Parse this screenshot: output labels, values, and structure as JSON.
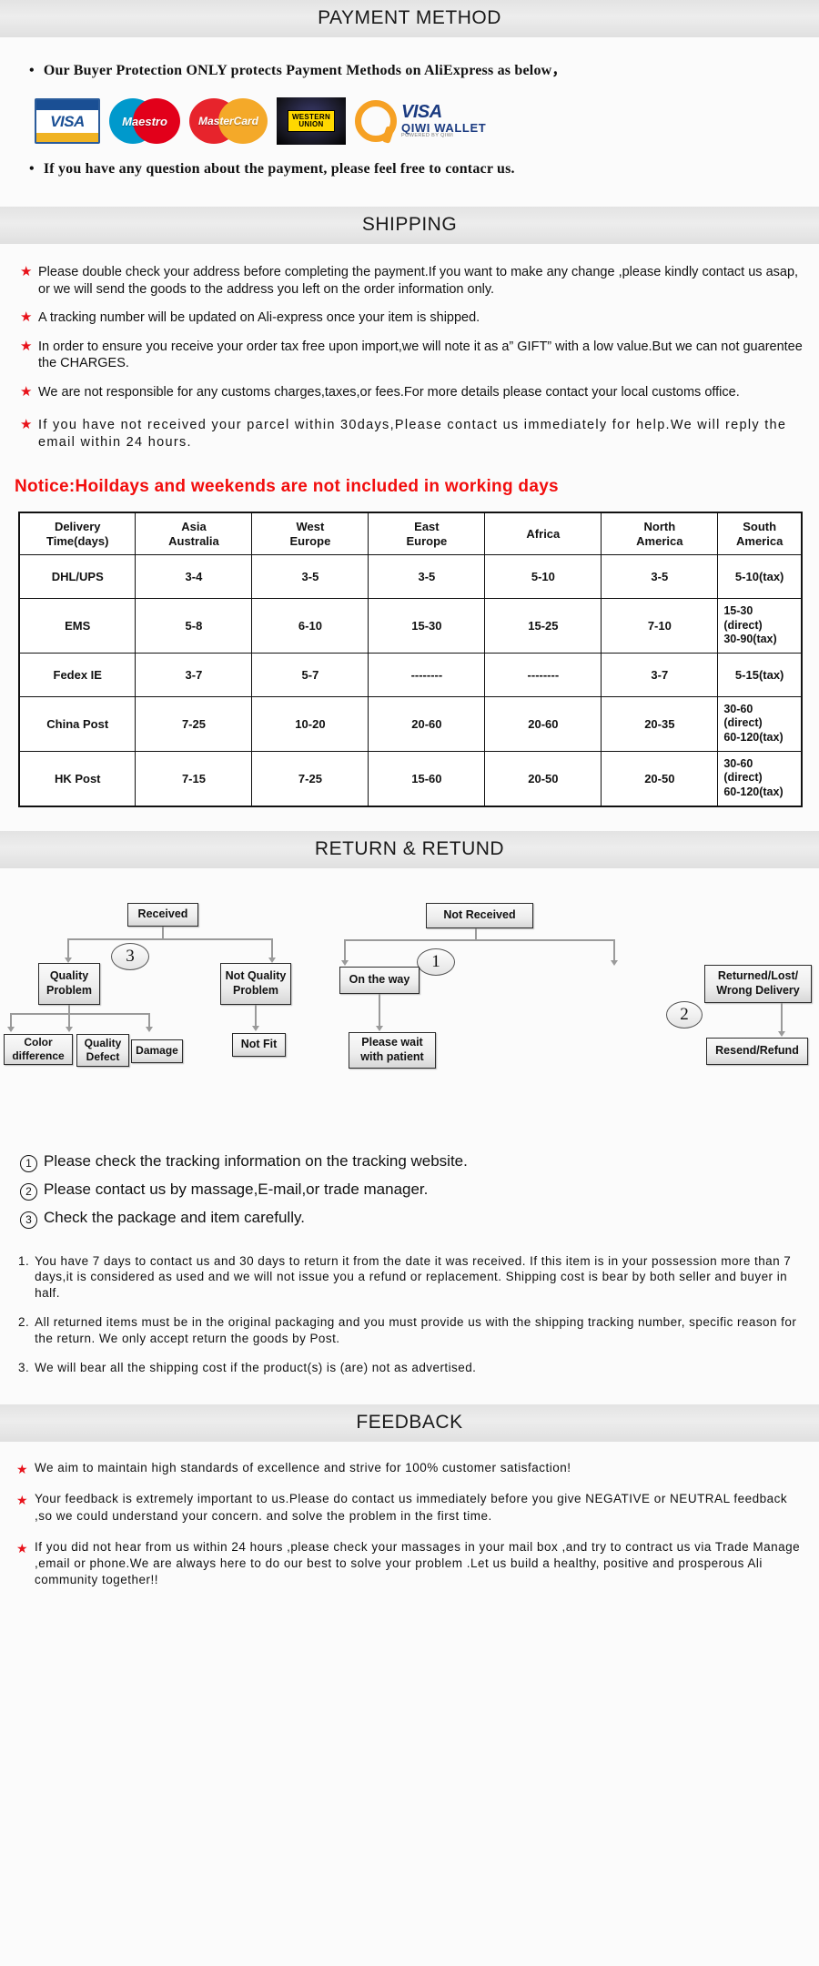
{
  "sections": {
    "payment_title": "PAYMENT METHOD",
    "shipping_title": "SHIPPING",
    "return_title": "RETURN & RETUND",
    "feedback_title": "FEEDBACK"
  },
  "payment": {
    "bullet": "•",
    "line1": "Our Buyer Protection ONLY protects Payment Methods on AliExpress as below，",
    "line2": "If you have any question about the payment, please feel free to contacr us.",
    "logos": [
      {
        "name": "visa-logo",
        "label": "VISA"
      },
      {
        "name": "maestro-logo",
        "label": "Maestro"
      },
      {
        "name": "mastercard-logo",
        "label": "MasterCard"
      },
      {
        "name": "western-union-logo",
        "label_top": "WESTERN",
        "label_bottom": "UNION"
      },
      {
        "name": "qiwi-wallet-logo",
        "label_visa": "VISA",
        "label_wallet": "QIWI WALLET",
        "label_powered": "POWERED BY QIWI"
      }
    ]
  },
  "shipping": {
    "star": "★",
    "items": [
      "Please double check your address before completing the payment.If you want to make any change ,please kindly contact us asap, or we will send the goods to the address you left on the order information only.",
      "A tracking number will be updated on Ali-express once your item is shipped.",
      "In order to ensure you receive your order tax free upon import,we will note it as a” GIFT” with a low value.But we can not guarentee the CHARGES.",
      "We are not responsible for any customs charges,taxes,or fees.For more details please contact your local customs office.",
      "If you have not received your parcel within 30days,Please contact us immediately for help.We will reply the email within 24 hours."
    ],
    "notice": "Notice:Hoildays and weekends are not included in working days",
    "notice_color": "#f20d0d"
  },
  "shipping_table": {
    "headers": [
      "Delivery Time(days)",
      "Asia Australia",
      "West Europe",
      "East Europe",
      "Africa",
      "North America",
      "South America"
    ],
    "header_lines": [
      [
        "Delivery",
        "Time(days)"
      ],
      [
        "Asia",
        "Australia"
      ],
      [
        "West",
        "Europe"
      ],
      [
        "East",
        "Europe"
      ],
      [
        "Africa"
      ],
      [
        "North",
        "America"
      ],
      [
        "South",
        "America"
      ]
    ],
    "rows": [
      {
        "method": "DHL/UPS",
        "cells": [
          "3-4",
          "3-5",
          "3-5",
          "5-10",
          "3-5",
          "5-10(tax)"
        ]
      },
      {
        "method": "EMS",
        "cells": [
          "5-8",
          "6-10",
          "15-30",
          "15-25",
          "7-10",
          "15-30\n(direct)\n30-90(tax)"
        ]
      },
      {
        "method": "Fedex IE",
        "cells": [
          "3-7",
          "5-7",
          "--------",
          "--------",
          "3-7",
          "5-15(tax)"
        ]
      },
      {
        "method": "China Post",
        "cells": [
          "7-25",
          "10-20",
          "20-60",
          "20-60",
          "20-35",
          "30-60\n(direct)\n60-120(tax)"
        ]
      },
      {
        "method": "HK Post",
        "cells": [
          "7-15",
          "7-25",
          "15-60",
          "20-50",
          "20-50",
          "30-60\n(direct)\n60-120(tax)"
        ]
      }
    ]
  },
  "flowchart": {
    "left": {
      "root": "Received",
      "badge": "3",
      "branch_a": "Quality Problem",
      "branch_b": "Not Quality Problem",
      "leaves_a": [
        "Color difference",
        "Quality Defect",
        "Damage"
      ],
      "leaves_b": [
        "Not Fit"
      ]
    },
    "right": {
      "root": "Not  Received",
      "badge1": "1",
      "badge2": "2",
      "branch_a": "On the way",
      "branch_b": "Returned/Lost/ Wrong Delivery",
      "leaf_a": "Please wait with patient",
      "leaf_b": "Resend/Refund"
    }
  },
  "numbered_steps": [
    {
      "num": "①",
      "text": "Please check the tracking information on the tracking website."
    },
    {
      "num": "②",
      "text": "Please contact us by  massage,E-mail,or trade manager."
    },
    {
      "num": "③",
      "text": "Check the package and item carefully."
    }
  ],
  "policy": [
    {
      "n": "1.",
      "text": "You have 7 days to contact us and 30 days to return it from the date it was received. If this item is in your possession more than 7 days,it is considered as used and we will not issue you a refund or replacement. Shipping cost is bear by both seller and buyer in half."
    },
    {
      "n": "2.",
      "text": "All returned items must be in the original packaging and you must provide us with the shipping tracking number, specific reason for the return. We only accept return the goods by Post."
    },
    {
      "n": "3.",
      "text": "We will bear all the shipping cost if the product(s) is (are) not as advertised."
    }
  ],
  "feedback": {
    "star": "★",
    "items": [
      "We aim to maintain high standards of excellence and strive  for 100% customer satisfaction!",
      "Your feedback is extremely important to us.Please do contact us immediately before you give NEGATIVE or NEUTRAL feedback ,so  we could understand your concern. and solve the problem in the first time.",
      "If you did not hear from us within 24 hours ,please check your massages in your mail box ,and try to contract us via Trade Manage ,email or phone.We are always here to do our best to solve your problem .Let us build a healthy, positive and prosperous Ali community together!!"
    ]
  }
}
